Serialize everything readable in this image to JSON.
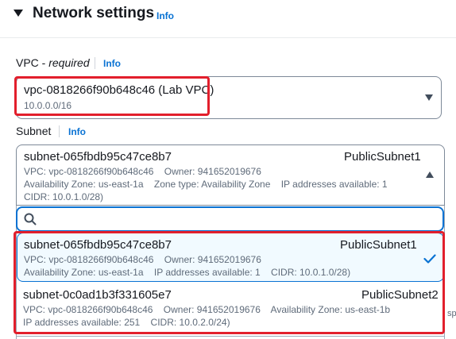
{
  "section": {
    "title": "Network settings",
    "info": "Info"
  },
  "vpc": {
    "label_main": "VPC - ",
    "label_required": "required",
    "info": "Info",
    "value": "vpc-0818266f90b648c46 (Lab VPC)",
    "cidr": "10.0.0.0/16"
  },
  "subnet": {
    "label": "Subnet",
    "info": "Info",
    "selected": {
      "name": "subnet-065fbdb95c47ce8b7",
      "tag": "PublicSubnet1",
      "line1": "VPC: vpc-0818266f90b648c46    Owner: 941652019676",
      "line2": "Availability Zone: us-east-1a    Zone type: Availability Zone    IP addresses available: 1",
      "line3": "CIDR: 10.0.1.0/28)"
    },
    "filter_placeholder": "",
    "options": [
      {
        "name": "subnet-065fbdb95c47ce8b7",
        "tag": "PublicSubnet1",
        "line1": "VPC: vpc-0818266f90b648c46    Owner: 941652019676",
        "line2": "Availability Zone: us-east-1a    IP addresses available: 1    CIDR: 10.0.1.0/28)"
      },
      {
        "name": "subnet-0c0ad1b3f331605e7",
        "tag": "PublicSubnet2",
        "line1": "VPC: vpc-0818266f90b648c46    Owner: 941652019676    Availability Zone: us-east-1b",
        "line2": "IP addresses available: 251    CIDR: 10.0.2.0/24)"
      }
    ],
    "background_stub": "sp"
  },
  "colors": {
    "accent": "#0972d3",
    "highlight": "#e21f2c",
    "text": "#16191f",
    "muted": "#5f6b7a"
  }
}
